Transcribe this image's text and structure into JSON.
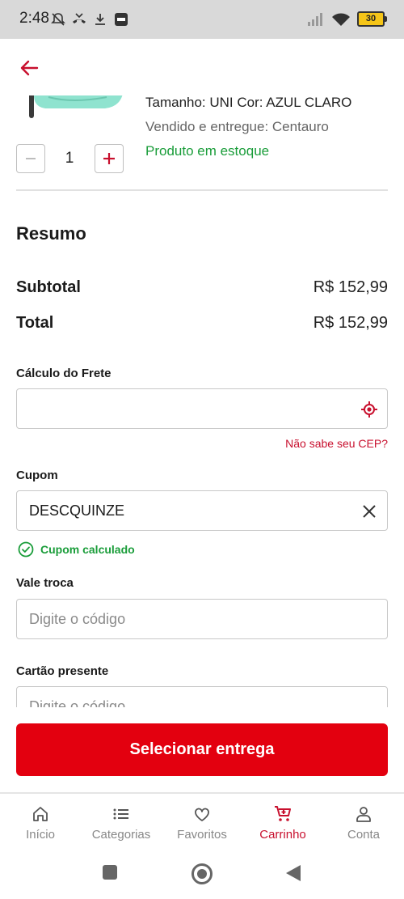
{
  "status_bar": {
    "time": "2:48",
    "battery": "30"
  },
  "header": {
    "back_icon": "arrow-left-icon",
    "accent_color": "#c8102e"
  },
  "product": {
    "size_color": "Tamanho: UNI   Cor: AZUL CLARO",
    "seller": "Vendido e entregue: Centauro",
    "stock": "Produto em estoque",
    "quantity": "1"
  },
  "summary": {
    "title": "Resumo",
    "subtotal_label": "Subtotal",
    "subtotal_value": "R$ 152,99",
    "total_label": "Total",
    "total_value": "R$ 152,99"
  },
  "shipping": {
    "label": "Cálculo do Frete",
    "value": "",
    "placeholder": "",
    "cep_link": "Não sabe seu CEP?"
  },
  "coupon": {
    "label": "Cupom",
    "value": "DESCQUINZE",
    "status": "Cupom calculado"
  },
  "exchange_voucher": {
    "label": "Vale troca",
    "placeholder": "Digite o código"
  },
  "gift_card": {
    "label": "Cartão presente",
    "placeholder": "Digite o código"
  },
  "cta": {
    "label": "Selecionar entrega",
    "color": "#e3000f"
  },
  "bottom_nav": {
    "items": [
      {
        "label": "Início",
        "icon": "home-icon"
      },
      {
        "label": "Categorias",
        "icon": "list-icon"
      },
      {
        "label": "Favoritos",
        "icon": "heart-icon"
      },
      {
        "label": "Carrinho",
        "icon": "cart-icon",
        "active": true
      },
      {
        "label": "Conta",
        "icon": "user-icon"
      }
    ]
  },
  "colors": {
    "success": "#1a9d3a",
    "brand_red": "#e3000f"
  }
}
